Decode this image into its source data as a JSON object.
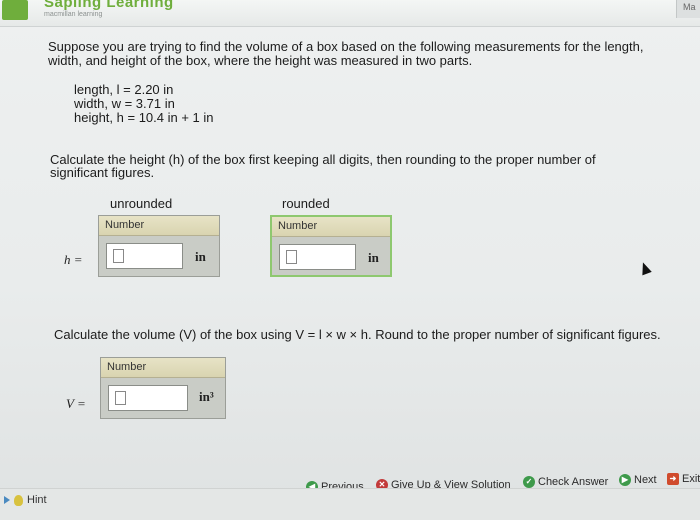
{
  "header": {
    "brand": "Sapling Learning",
    "sub_brand": "macmillan learning",
    "corner_tab": "Ma"
  },
  "problem": {
    "prompt": "Suppose you are trying to find the volume of a box based on the following measurements for the length, width, and height of the box, where the height was measured in two parts.",
    "given": {
      "length": "length, l = 2.20 in",
      "width": "width, w = 3.71 in",
      "height": "height, h = 10.4 in + 1 in"
    }
  },
  "part1": {
    "question": "Calculate the height (h) of the box first keeping all digits, then rounding to the proper number of significant figures.",
    "unrounded_label": "unrounded",
    "rounded_label": "rounded",
    "variable": "h =",
    "unrounded_box": {
      "header": "Number",
      "value": "",
      "unit": "in"
    },
    "rounded_box": {
      "header": "Number",
      "value": "",
      "unit": "in"
    }
  },
  "part2": {
    "question": "Calculate the volume (V) of the box using V = l × w × h. Round to the proper number of significant figures.",
    "variable": "V =",
    "box": {
      "header": "Number",
      "value": "",
      "unit": "in³"
    }
  },
  "nav": {
    "previous": "Previous",
    "give_up": "Give Up & View Solution",
    "check_answer": "Check Answer",
    "next": "Next",
    "exit": "Exit"
  },
  "hint": "Hint"
}
